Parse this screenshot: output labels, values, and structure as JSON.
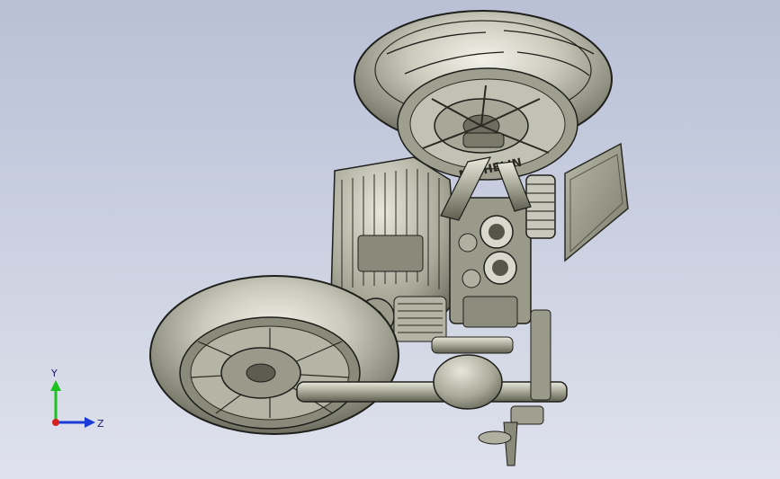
{
  "viewport": {
    "background_top": "#b9c0d6",
    "background_bottom": "#dfe2ec",
    "model_body_color": "#8f8f80",
    "model_highlight_color": "#e6e6da",
    "model_edge_color": "#1e1e1a"
  },
  "triad": {
    "y_label": "Y",
    "z_label": "Z",
    "y_color": "#1ec21e",
    "z_color": "#1a3cd6",
    "x_color": "#d62020"
  },
  "model": {
    "parts": [
      "front-wheel",
      "front-tire-tread",
      "front-brake-disc",
      "front-fork",
      "engine-block",
      "carburetors",
      "rear-shock",
      "license-plate",
      "rear-wheel",
      "rear-brake-disc",
      "swingarm",
      "handlebar-lever",
      "footpeg"
    ],
    "tire_text": "MICHELIN"
  }
}
